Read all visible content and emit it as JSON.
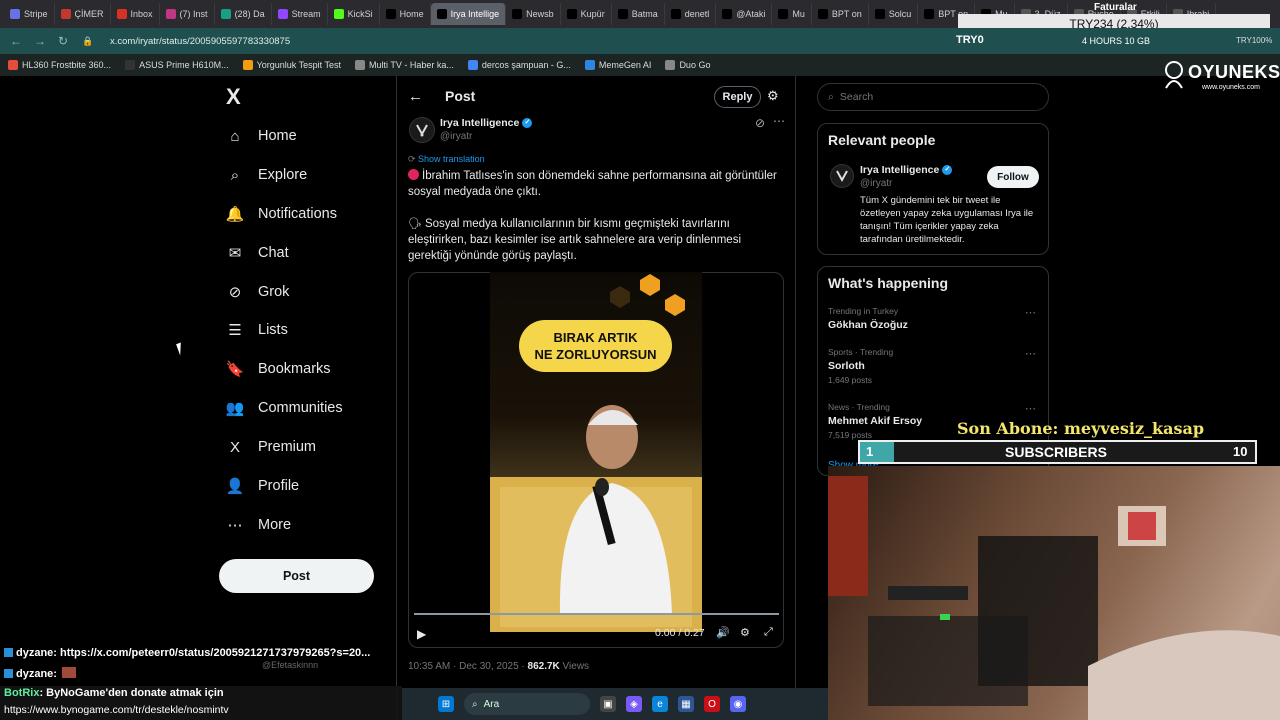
{
  "browser": {
    "tabs": [
      {
        "label": "Stripe",
        "color": "#6772e5"
      },
      {
        "label": "ÇİMER",
        "color": "#c0392b"
      },
      {
        "label": "Inbox",
        "color": "#d93025"
      },
      {
        "label": "(7) Inst",
        "color": "#c13584"
      },
      {
        "label": "(28) Da",
        "color": "#16a085"
      },
      {
        "label": "Stream",
        "color": "#9146ff"
      },
      {
        "label": "KickSi",
        "color": "#53fc18"
      },
      {
        "label": "Home",
        "color": "#000000"
      },
      {
        "label": "Irya Intellige",
        "color": "#000000",
        "active": true
      },
      {
        "label": "Newsb",
        "color": "#000000"
      },
      {
        "label": "Kupür",
        "color": "#000000"
      },
      {
        "label": "Batma",
        "color": "#000000"
      },
      {
        "label": "denetl",
        "color": "#000000"
      },
      {
        "label": "@Ataki",
        "color": "#000000"
      },
      {
        "label": "Mu",
        "color": "#000000"
      },
      {
        "label": "BPT on",
        "color": "#000000"
      },
      {
        "label": "Solcu",
        "color": "#000000"
      },
      {
        "label": "BPT on",
        "color": "#000000"
      },
      {
        "label": "Mu",
        "color": "#000000"
      },
      {
        "label": "3. Düz",
        "color": "#555555"
      },
      {
        "label": "Rusho",
        "color": "#555555"
      },
      {
        "label": "Etkili",
        "color": "#555555"
      },
      {
        "label": "Ibrahi",
        "color": "#555555"
      }
    ],
    "url": "x.com/iryatr/status/2005905597783330875",
    "bookmarks": [
      {
        "label": "HL360 Frostbite 360...",
        "color": "#e74c3c"
      },
      {
        "label": "ASUS Prime H610M...",
        "color": "#333333"
      },
      {
        "label": "Yorgunluk Tespit Test",
        "color": "#f39c12"
      },
      {
        "label": "Multi TV - Haber ka...",
        "color": "#888888"
      },
      {
        "label": "dercos şampuan - G...",
        "color": "#4285f4"
      },
      {
        "label": "MemeGen AI",
        "color": "#2e86de"
      },
      {
        "label": "Duo Go",
        "color": "#888888"
      }
    ],
    "ticker": "TRY234 (2.34%)",
    "ticker_left": "TRY0",
    "faturalar": "Faturalar",
    "hours": "4 HOURS 10 GB",
    "try_right": "TRY100%",
    "brand_name": "OYUNEKS",
    "brand_url": "www.oyuneks.com"
  },
  "xnav": {
    "logo": "X",
    "items": [
      {
        "label": "Home",
        "icon": "home-icon",
        "glyph": "⌂"
      },
      {
        "label": "Explore",
        "icon": "search-icon",
        "glyph": "⌕"
      },
      {
        "label": "Notifications",
        "icon": "bell-icon",
        "glyph": "🔔"
      },
      {
        "label": "Chat",
        "icon": "mail-icon",
        "glyph": "✉"
      },
      {
        "label": "Grok",
        "icon": "grok-icon",
        "glyph": "⊘"
      },
      {
        "label": "Lists",
        "icon": "list-icon",
        "glyph": "☰"
      },
      {
        "label": "Bookmarks",
        "icon": "bookmark-icon",
        "glyph": "🔖"
      },
      {
        "label": "Communities",
        "icon": "communities-icon",
        "glyph": "👥"
      },
      {
        "label": "Premium",
        "icon": "x-premium-icon",
        "glyph": "X"
      },
      {
        "label": "Profile",
        "icon": "person-icon",
        "glyph": "👤"
      },
      {
        "label": "More",
        "icon": "more-circle-icon",
        "glyph": "⋯"
      }
    ],
    "post_label": "Post"
  },
  "post": {
    "header_title": "Post",
    "reply_label": "Reply",
    "author_name": "Irya Intelligence",
    "author_handle": "@iryatr",
    "show_translation": "Show translation",
    "para1": "İbrahim Tatlıses'in son dönemdeki sahne performansına ait görüntüler sosyal medyada öne çıktı.",
    "para2": "Sosyal medya kullanıcılarının bir kısmı geçmişteki tavırlarını eleştirirken, bazı kesimler ise artık sahnelere ara verip dinlenmesi gerektiği yönünde görüş paylaştı.",
    "video_caption_line1": "BIRAK ARTIK",
    "video_caption_line2": "NE ZORLUYORSUN",
    "video_time": "0:00 / 0:27",
    "video_progress": 0,
    "timestamp": "10:35 AM · Dec 30, 2025 · ",
    "views_count": "862.7K",
    "views_label": " Views"
  },
  "sidebar": {
    "search_placeholder": "Search",
    "relevant_title": "Relevant people",
    "rel_name": "Irya Intelligence",
    "rel_handle": "@iryatr",
    "follow_label": "Follow",
    "rel_bio": "Tüm X gündemini tek bir tweet ile özetleyen yapay zeka uygulaması Irya ile tanışın! Tüm içerikler yapay zeka tarafından üretilmektedir.",
    "happening_title": "What's happening",
    "trends": [
      {
        "category": "Trending in Turkey",
        "title": "Gökhan Özoğuz",
        "count": ""
      },
      {
        "category": "Sports · Trending",
        "title": "Sorloth",
        "count": "1,649 posts"
      },
      {
        "category": "News · Trending",
        "title": "Mehmet Akif Ersoy",
        "count": "7,519 posts"
      }
    ],
    "show_more": "Show more"
  },
  "stream": {
    "son_abone": "Son Abone: meyvesiz_kasap",
    "sub_current": "1",
    "sub_label": "SUBSCRIBERS",
    "sub_goal": "10",
    "sub_progress": 0.1
  },
  "chat": {
    "lines": [
      {
        "user": "dyzane",
        "text": ": https://x.com/peteerr0/status/2005921271737979265?s=20..."
      },
      {
        "user": "dyzane",
        "text": ": "
      }
    ],
    "ghost": "@Efetaskinnn",
    "bot_user": "BotRix",
    "bot_text": ": ByNoGame'den donate atmak için",
    "bot_url": "https://www.bynogame.com/tr/destekle/nosmintv"
  },
  "taskbar": {
    "search_label": "Ara"
  }
}
